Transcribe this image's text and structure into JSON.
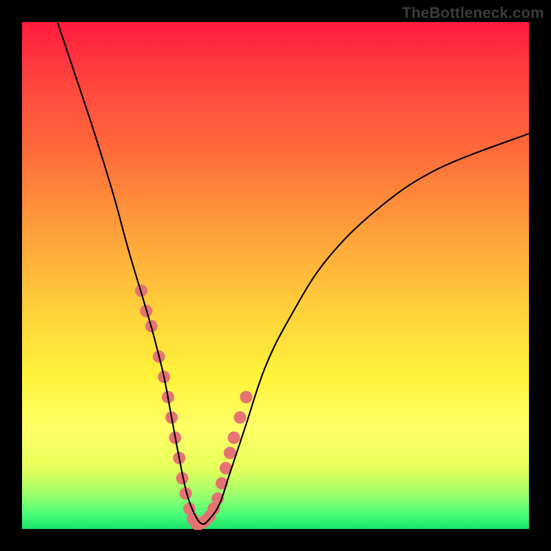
{
  "watermark": "TheBottleneck.com",
  "chart_data": {
    "type": "line",
    "title": "",
    "xlabel": "",
    "ylabel": "",
    "xlim": [
      0,
      100
    ],
    "ylim": [
      0,
      100
    ],
    "grid": false,
    "legend": false,
    "series": [
      {
        "name": "main-curve",
        "color": "#000000",
        "x": [
          7,
          10,
          14,
          18,
          21,
          24,
          26,
          28,
          29.5,
          31,
          32.5,
          34,
          35.5,
          37,
          39,
          41,
          44,
          48,
          53,
          60,
          70,
          82,
          100
        ],
        "y": [
          100,
          91,
          79,
          66,
          55,
          45,
          38,
          30,
          22,
          14,
          7,
          3,
          1,
          2,
          5,
          11,
          20,
          32,
          42,
          53,
          63,
          71,
          78
        ]
      },
      {
        "name": "highlight-dots",
        "color": "#e57373",
        "type": "scatter",
        "x": [
          23.5,
          24.5,
          25.5,
          27.0,
          28.0,
          28.8,
          29.5,
          30.2,
          31.0,
          31.6,
          32.3,
          33.0,
          33.7,
          34.4,
          35.0,
          36.0,
          37.0,
          37.8,
          38.6,
          39.4,
          40.2,
          41.0,
          41.8,
          43.0,
          44.2
        ],
        "y": [
          47,
          43,
          40,
          34,
          30,
          26,
          22,
          18,
          14,
          10,
          7,
          4,
          2,
          1,
          1,
          1.5,
          2.5,
          4,
          6,
          9,
          12,
          15,
          18,
          22,
          26
        ]
      }
    ]
  }
}
